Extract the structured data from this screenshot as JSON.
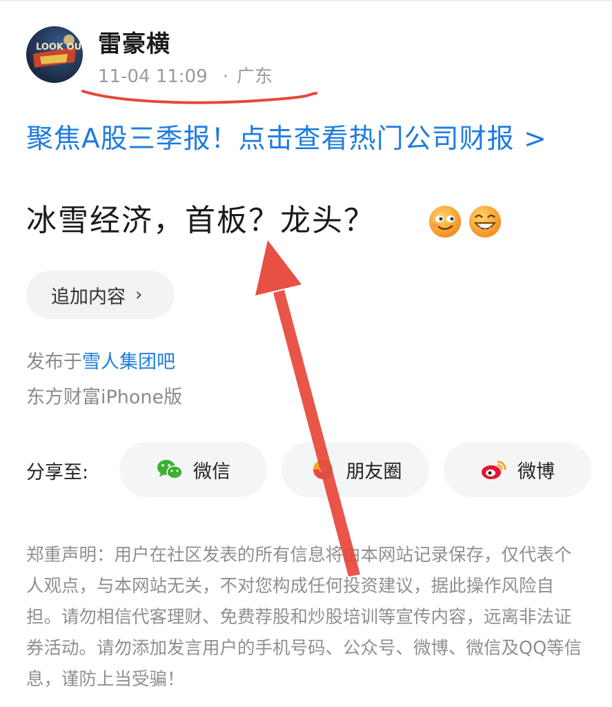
{
  "post": {
    "author": "雷豪横",
    "date": "11-04 11:09",
    "location_separator": "·",
    "location": "广东",
    "avatar_text": "LOOK OUT",
    "promo_link": "聚焦A股三季报！点击查看热门公司财报 >",
    "title": "冰雪经济，首板？龙头？",
    "emojis": [
      "grin-emoji",
      "laugh-emoji"
    ],
    "append_label": "追加内容",
    "append_chevron": "›",
    "posted_in_prefix": "发布于",
    "forum_name": "雪人集团吧",
    "client": "东方财富iPhone版"
  },
  "share": {
    "label": "分享至:",
    "wechat": "微信",
    "moments": "朋友圈",
    "weibo": "微博"
  },
  "disclaimer": "郑重声明：用户在社区发表的所有信息将由本网站记录保存，仅代表个人观点，与本网站无关，不对您构成任何投资建议，据此操作风险自担。请勿相信代客理财、免费荐股和炒股培训等宣传内容，远离非法证券活动。请勿添加发言用户的手机号码、公众号、微博、微信及QQ等信息，谨防上当受骗！",
  "colors": {
    "link": "#1d7ce0",
    "annotation_red": "#e8473a",
    "muted_text": "#8f8f8f",
    "button_bg": "#f2f3f5"
  }
}
